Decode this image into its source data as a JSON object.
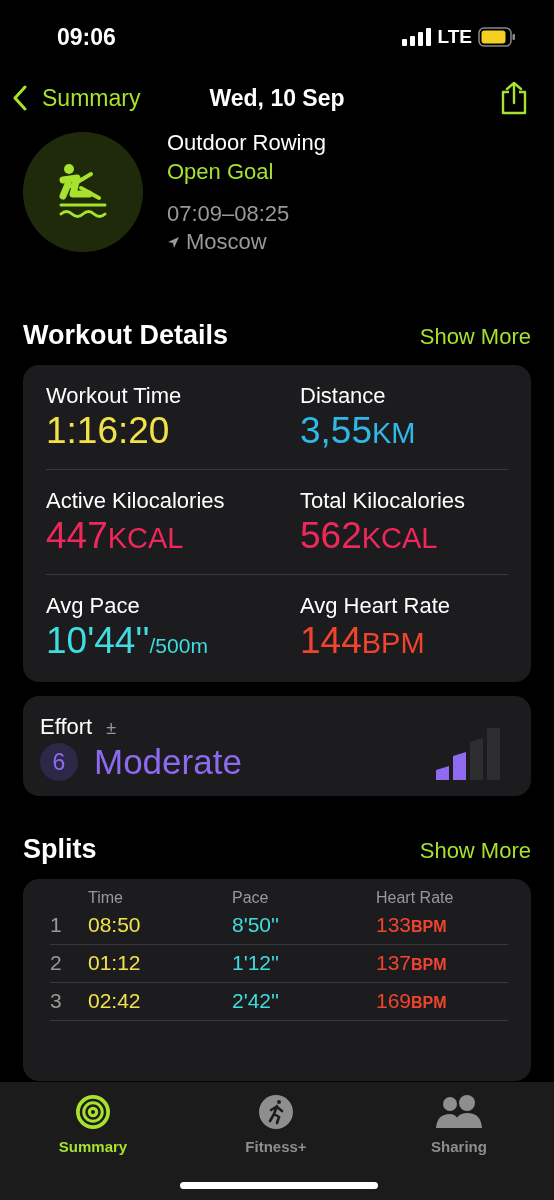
{
  "status_bar": {
    "time": "09:06",
    "network": "LTE"
  },
  "nav": {
    "back": "Summary",
    "title": "Wed, 10 Sep"
  },
  "workout": {
    "name": "Outdoor Rowing",
    "goal": "Open Goal",
    "time_range": "07:09–08:25",
    "location": "Moscow"
  },
  "details": {
    "title": "Workout Details",
    "action": "Show More",
    "metrics": [
      {
        "label": "Workout Time",
        "value": "1:16:20",
        "color": "#f2e24a"
      },
      {
        "label": "Distance",
        "value": "3,55",
        "unit": "KM",
        "color": "#2fb8e8"
      },
      {
        "label": "Active Kilocalories",
        "value": "447",
        "unit": "KCAL",
        "color": "#f0285a"
      },
      {
        "label": "Total Kilocalories",
        "value": "562",
        "unit": "KCAL",
        "color": "#f0285a"
      },
      {
        "label": "Avg Pace",
        "value": "10'44''",
        "suffix": "/500m",
        "color": "#3fdce0"
      },
      {
        "label": "Avg Heart Rate",
        "value": "144",
        "unit": "BPM",
        "color": "#f0442e"
      }
    ]
  },
  "effort": {
    "label": "Effort",
    "adjust": "±",
    "score": "6",
    "rating": "Moderate",
    "level": 0.5
  },
  "splits": {
    "title": "Splits",
    "action": "Show More",
    "columns": [
      "Time",
      "Pace",
      "Heart Rate"
    ],
    "rows": [
      {
        "index": "1",
        "time": "08:50",
        "pace": "8'50''",
        "heart_rate": "133",
        "unit": "BPM"
      },
      {
        "index": "2",
        "time": "01:12",
        "pace": "1'12''",
        "heart_rate": "137",
        "unit": "BPM"
      },
      {
        "index": "3",
        "time": "02:42",
        "pace": "2'42''",
        "heart_rate": "169",
        "unit": "BPM"
      }
    ]
  },
  "tabs": [
    {
      "label": "Summary",
      "kind": "rings",
      "selected": true
    },
    {
      "label": "Fitness+",
      "kind": "runner",
      "selected": false
    },
    {
      "label": "Sharing",
      "kind": "people",
      "selected": false
    }
  ]
}
